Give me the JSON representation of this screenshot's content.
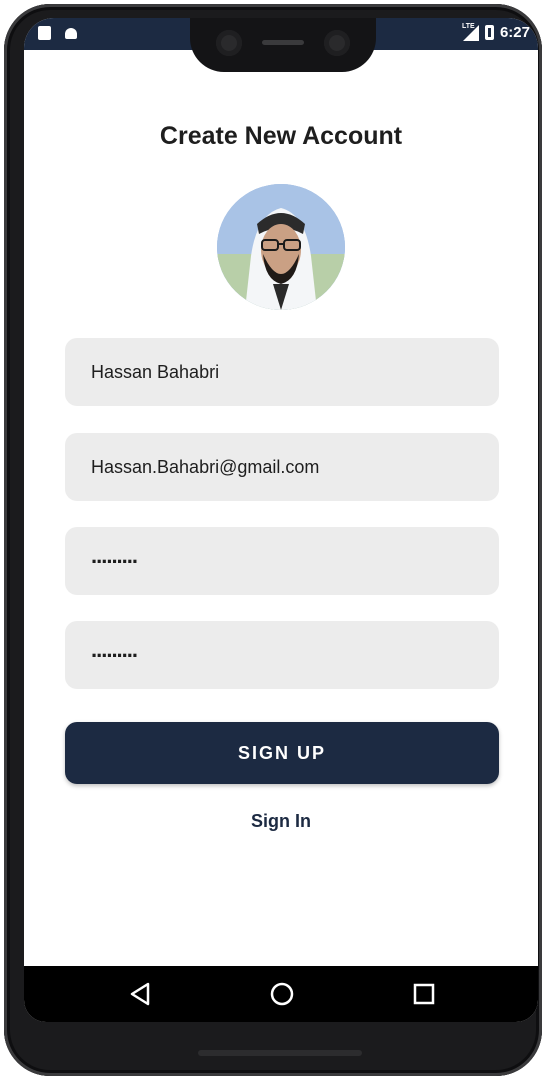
{
  "status_bar": {
    "time": "6:27",
    "network": "LTE",
    "left_icons": [
      "sd-card-icon",
      "android-icon"
    ],
    "right_icons": [
      "signal-icon",
      "battery-icon"
    ]
  },
  "screen": {
    "title": "Create New Account",
    "avatar_icon": "profile-photo"
  },
  "form": {
    "name_value": "Hassan Bahabri",
    "email_value": "Hassan.Bahabri@gmail.com",
    "password_value": ".........",
    "confirm_password_value": "........."
  },
  "actions": {
    "signup_label": "SIGN UP",
    "signin_label": "Sign In"
  },
  "nav": {
    "icons": [
      "back-icon",
      "home-icon",
      "recents-icon"
    ]
  },
  "colors": {
    "primary": "#1c2a42",
    "field_bg": "#ececec",
    "background": "#ffffff"
  }
}
